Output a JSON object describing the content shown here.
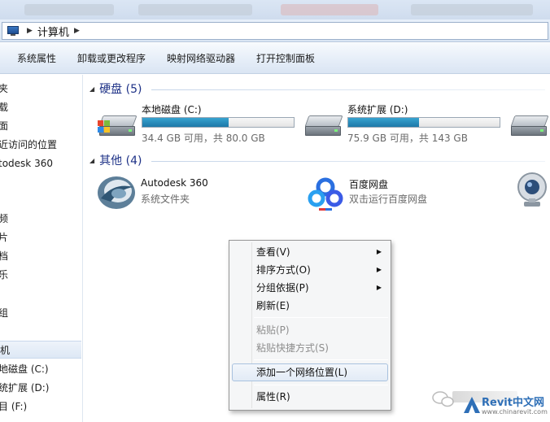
{
  "window": {
    "breadcrumb": "计算机"
  },
  "toolbar": {
    "items": [
      "系统属性",
      "卸载或更改程序",
      "映射网络驱动器",
      "打开控制面板"
    ]
  },
  "navpane": {
    "items": [
      "夹",
      "载",
      "面",
      "近访问的位置",
      "todesk 360",
      "频",
      "片",
      "档",
      "乐",
      "组",
      "机",
      "地磁盘 (C:)",
      "统扩展 (D:)",
      "目 (F:)"
    ],
    "selected_index": 10
  },
  "groups": {
    "drives": {
      "title": "硬盘 (5)"
    },
    "other": {
      "title": "其他 (4)"
    }
  },
  "drives": [
    {
      "name": "本地磁盘 (C:)",
      "free_text": "34.4 GB 可用，共 80.0 GB",
      "used_fraction": 0.57,
      "system": true
    },
    {
      "name": "系统扩展 (D:)",
      "free_text": "75.9 GB 可用，共 143 GB",
      "used_fraction": 0.47,
      "system": false
    }
  ],
  "others": [
    {
      "name": "Autodesk 360",
      "desc": "系统文件夹",
      "icon": "autodesk-360-icon"
    },
    {
      "name": "百度网盘",
      "desc": "双击运行百度网盘",
      "icon": "baidu-netdisk-icon"
    }
  ],
  "context_menu": {
    "view": "查看(V)",
    "sort": "排序方式(O)",
    "group": "分组依据(P)",
    "refresh": "刷新(E)",
    "paste": "粘贴(P)",
    "paste_shortcut": "粘贴快捷方式(S)",
    "add_network": "添加一个网络位置(L)",
    "properties": "属性(R)"
  },
  "watermark": {
    "brand": "Revit中文网",
    "url": "www.chinarevit.com"
  },
  "colors": {
    "drive_bar": "#2a8fbf",
    "group_header": "#1e3287",
    "menu_hover_border": "#a9c2df"
  }
}
